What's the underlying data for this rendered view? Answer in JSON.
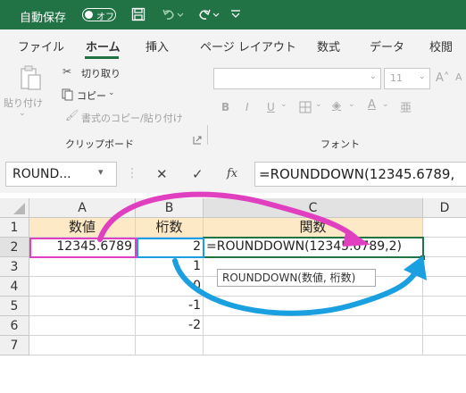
{
  "titlebar": {
    "autosave_label": "自動保存",
    "autosave_state": "オフ",
    "colors": {
      "bar": "#217346"
    }
  },
  "tabs": [
    "ファイル",
    "ホーム",
    "挿入",
    "ページ レイアウト",
    "数式",
    "データ",
    "校閲"
  ],
  "ribbon": {
    "cut": "切り取り",
    "copy": "コピー",
    "paste": "貼り付け",
    "format_painter": "書式のコピー/貼り付け",
    "clipboard_group": "クリップボード",
    "font_group": "フォント",
    "font_size": "11",
    "bold": "B",
    "italic": "I",
    "underline": "U"
  },
  "formula_bar": {
    "name_box": "ROUND...",
    "cancel": "✕",
    "enter": "✓",
    "fx": "fx",
    "formula": "=ROUNDDOWN(12345.6789,"
  },
  "grid": {
    "columns": [
      "A",
      "B",
      "C",
      "D"
    ],
    "rows": [
      "1",
      "2",
      "3",
      "4",
      "5",
      "6",
      "7"
    ],
    "headers": {
      "a": "数値",
      "b": "桁数",
      "c": "関数"
    },
    "a2": "12345.6789",
    "b_values": [
      "2",
      "1",
      "0",
      "-1",
      "-2"
    ],
    "c2": "=ROUNDDOWN(12345.6789,2)",
    "tooltip": "ROUNDDOWN(数値, 桁数)"
  },
  "annotation_colors": {
    "pink": "#e040c0",
    "blue": "#1aa0e0",
    "header_fill": "#fde9c6"
  }
}
